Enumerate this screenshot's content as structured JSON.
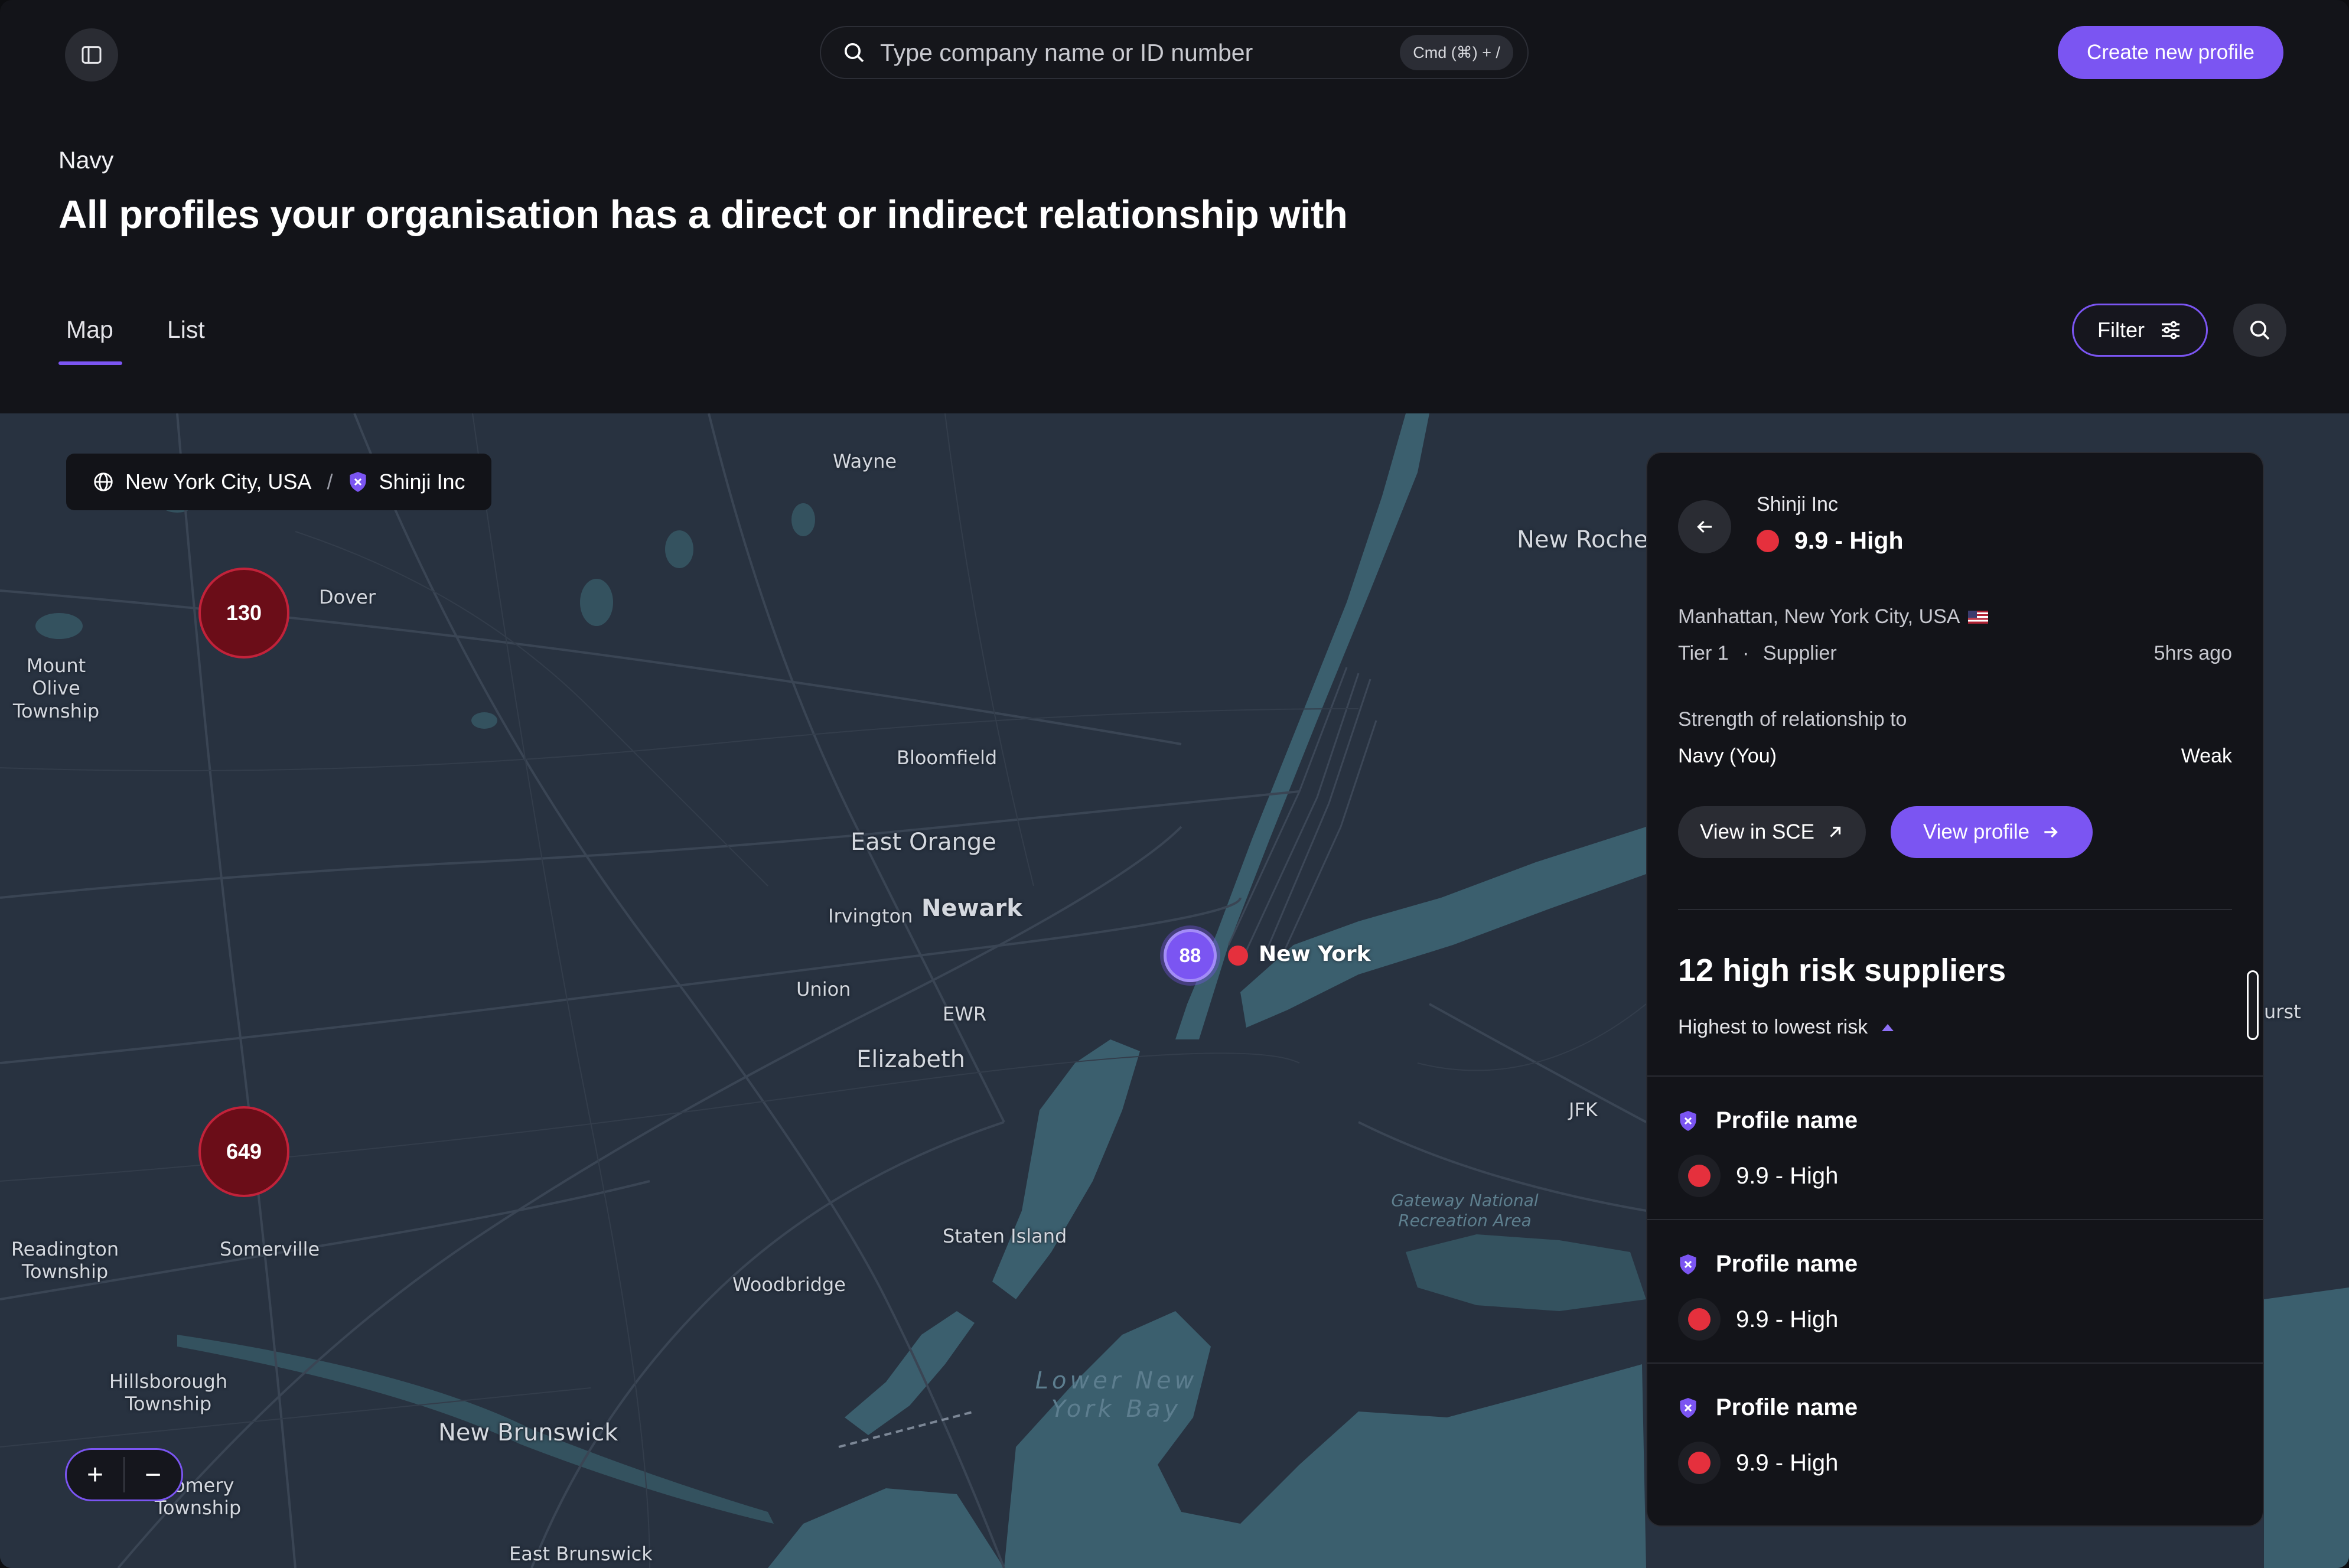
{
  "header": {
    "search_placeholder": "Type company name or ID number",
    "shortcut": "Cmd (⌘) + /",
    "create_button": "Create new profile"
  },
  "page": {
    "org_name": "Navy",
    "title": "All profiles your organisation has a direct or indirect relationship with"
  },
  "tabs": [
    {
      "label": "Map",
      "active": true
    },
    {
      "label": "List",
      "active": false
    }
  ],
  "toolbar": {
    "filter_label": "Filter"
  },
  "map": {
    "breadcrumb": {
      "location": "New York City, USA",
      "separator": "/",
      "company": "Shinji Inc"
    },
    "clusters": [
      {
        "count": "130",
        "color": "#6b0d18"
      },
      {
        "count": "649",
        "color": "#6b0d18"
      }
    ],
    "selected_cluster": {
      "count": "88",
      "color": "#7b55f2"
    },
    "selected_pin_label": "New York",
    "labels": {
      "wayne": "Wayne",
      "dover": "Dover",
      "mount_olive": "Mount Olive Township",
      "bloomfield": "Bloomfield",
      "east_orange": "East Orange",
      "irvington": "Irvington",
      "newark": "Newark",
      "union": "Union",
      "ewr": "EWR",
      "elizabeth": "Elizabeth",
      "new_rochelle": "New Rochell",
      "jfk": "JFK",
      "gateway": "Gateway National Recreation Area",
      "staten_island": "Staten Island",
      "woodbridge": "Woodbridge",
      "readington": "Readington Township",
      "somerville": "Somerville",
      "hillsborough": "Hillsborough Township",
      "new_brunswick": "New Brunswick",
      "montgomery": "gomery Township",
      "east_brunswick": "East Brunswick",
      "lower_bay": "Lower New York Bay",
      "hurst": "urst"
    },
    "zoom": {
      "in": "+",
      "out": "−"
    }
  },
  "panel": {
    "company": "Shinji Inc",
    "score": "9.9 - High",
    "location": "Manhattan, New York City, USA",
    "tier": "Tier 1",
    "tier_sep": "·",
    "role": "Supplier",
    "updated": "5hrs ago",
    "strength_label": "Strength of relationship to",
    "relation_org": "Navy (You)",
    "strength_value": "Weak",
    "view_sce": "View in SCE",
    "view_profile": "View profile",
    "list_title": "12 high risk suppliers",
    "sort_label": "Highest to lowest risk",
    "suppliers": [
      {
        "name": "Profile name",
        "score": "9.9 - High"
      },
      {
        "name": "Profile name",
        "score": "9.9 - High"
      },
      {
        "name": "Profile name",
        "score": "9.9 - High"
      }
    ]
  },
  "colors": {
    "accent": "#7b55f2",
    "risk_high": "#e5303d",
    "background": "#131419",
    "map_land": "#283240",
    "map_water": "#3b5f6e"
  }
}
